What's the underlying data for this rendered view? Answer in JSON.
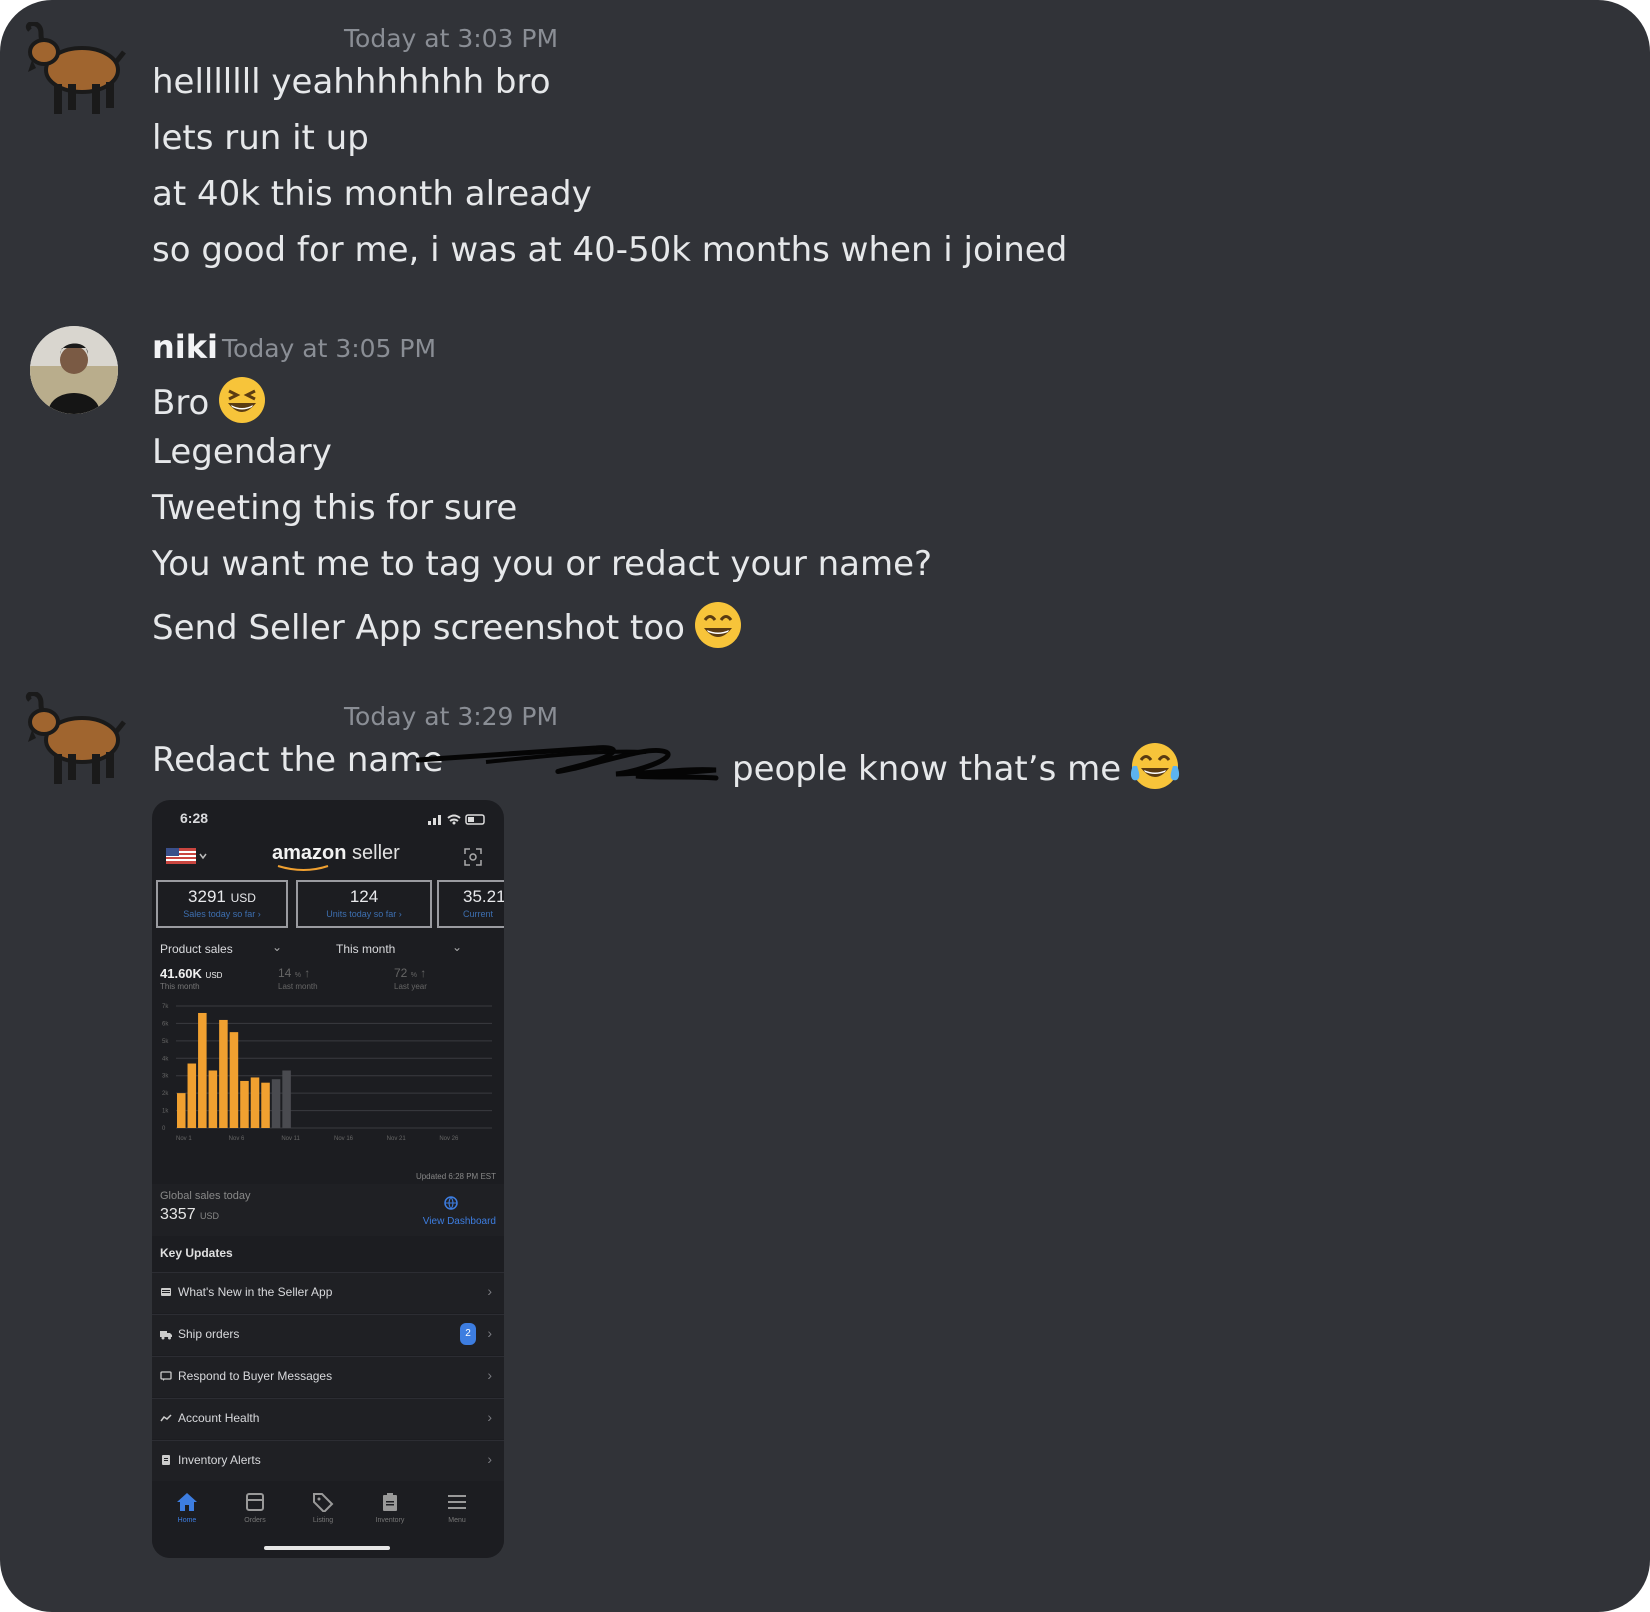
{
  "messages": [
    {
      "timestamp": "Today at 3:03 PM",
      "lines": [
        "helllllll yeahhhhhhh bro",
        "lets run it up",
        "at 40k this month already",
        "so good for me, i was at 40-50k months when i joined"
      ]
    },
    {
      "username": "niki",
      "timestamp": "Today at 3:05 PM",
      "lines": [
        "Bro",
        "Legendary",
        "Tweeting this for sure",
        "You want me to tag you or redact your name?",
        "Send Seller App screenshot too"
      ]
    },
    {
      "timestamp": "Today at 3:29 PM",
      "line_before": "Redact the name",
      "line_after": "people know that’s me"
    }
  ],
  "icons": {
    "goat_avatar": "goat-emoji",
    "grin_emoji": "grinning-squinting-face",
    "smile_emoji": "grinning-face-smiling-eyes",
    "laugh_emoji": "face-with-tears-of-joy"
  },
  "phone": {
    "time": "6:28",
    "brand": "amazon",
    "brand_suffix": "seller",
    "stats": [
      {
        "value": "3291",
        "unit": "USD",
        "caption": "Sales today so far ›"
      },
      {
        "value": "124",
        "unit": "",
        "caption": "Units today so far ›"
      },
      {
        "value": "35.21",
        "unit": "",
        "caption": "Current"
      }
    ],
    "section_label": "Product sales",
    "period_label": "This month",
    "summary": {
      "value": "41.60K",
      "unit": "USD",
      "value_caption": "This month",
      "mom": "14",
      "mom_caption": "Last month",
      "yoy": "72",
      "yoy_caption": "Last year",
      "pct": "%"
    },
    "updated_text": "Updated 6:28 PM EST",
    "global_label": "Global sales today",
    "global_value": "3357",
    "global_unit": "USD",
    "view_dashboard": "View Dashboard",
    "key_updates": "Key Updates",
    "rows": [
      {
        "label": "What's New in the Seller App"
      },
      {
        "label": "Ship orders",
        "badge": "2"
      },
      {
        "label": "Respond to Buyer Messages"
      },
      {
        "label": "Account Health"
      },
      {
        "label": "Inventory Alerts"
      }
    ],
    "nav": [
      "Home",
      "Orders",
      "Listing",
      "Inventory",
      "Menu"
    ],
    "colors": {
      "bar": "#f0a030",
      "bar_current": "#4a4b50",
      "accent": "#3d7de0"
    }
  },
  "chart_data": {
    "type": "bar",
    "categories": [
      "Nov 1",
      "Nov 2",
      "Nov 3",
      "Nov 4",
      "Nov 5",
      "Nov 6",
      "Nov 7",
      "Nov 8",
      "Nov 9",
      "Nov 10",
      "Nov 11"
    ],
    "tick_labels": [
      "Nov 1",
      "Nov 6",
      "Nov 11",
      "Nov 16",
      "Nov 21",
      "Nov 26"
    ],
    "values": [
      2000,
      3700,
      6600,
      3300,
      6200,
      5500,
      2700,
      2900,
      2600,
      2800,
      3300
    ],
    "series_colors": [
      "#f0a030",
      "#f0a030",
      "#f0a030",
      "#f0a030",
      "#f0a030",
      "#f0a030",
      "#f0a030",
      "#f0a030",
      "#f0a030",
      "#4a4b50",
      "#4a4b50"
    ],
    "ylim": [
      0,
      7000
    ],
    "yticks": [
      "0",
      "1k",
      "2k",
      "3k",
      "4k",
      "5k",
      "6k",
      "7k"
    ],
    "grid": true
  }
}
